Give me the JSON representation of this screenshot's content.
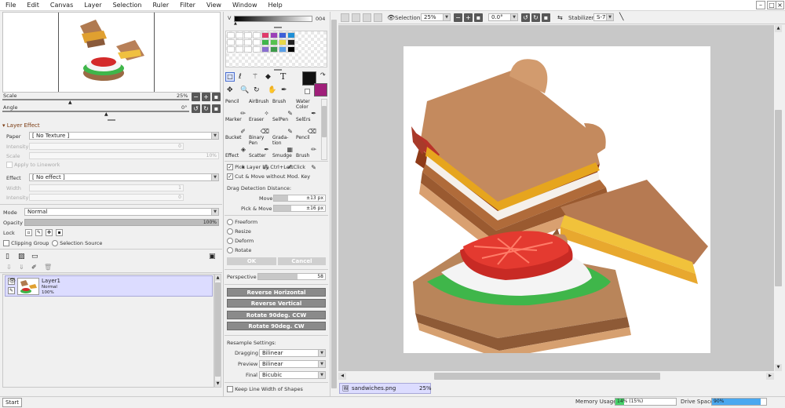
{
  "menu": [
    "File",
    "Edit",
    "Canvas",
    "Layer",
    "Selection",
    "Ruler",
    "Filter",
    "View",
    "Window",
    "Help"
  ],
  "window_controls": [
    "–",
    "□",
    "×"
  ],
  "navigator": {
    "scale_label": "Scale",
    "scale_value": "25%",
    "angle_label": "Angle",
    "angle_value": "0°"
  },
  "layer_effect": {
    "title": "Layer Effect",
    "paper_label": "Paper",
    "paper_value": "[ No Texture ]",
    "intensity_label": "Intensity",
    "intensity_value": "0",
    "scale_label": "Scale",
    "scale_value": "10%",
    "apply_linework": "Apply to Linework",
    "effect_label": "Effect",
    "effect_value": "[ No effect ]",
    "width_label": "Width",
    "width_value": "1",
    "intensity2_label": "Intensity",
    "intensity2_value": "0"
  },
  "layer_props": {
    "mode_label": "Mode",
    "mode_value": "Normal",
    "opacity_label": "Opacity",
    "opacity_value": "100%",
    "lock_label": "Lock",
    "clipping_group": "Clipping Group",
    "selection_source": "Selection Source"
  },
  "layers": [
    {
      "name": "Layer1",
      "mode": "Normal",
      "opacity": "100%"
    }
  ],
  "color": {
    "value_label": "V",
    "value": "004"
  },
  "swatches": [
    "#ffffff",
    "#ffffff",
    "#ffffff",
    "#ffffff",
    "#e03a6a",
    "#9b3fb8",
    "#3c5fd8",
    "#1f8fd6",
    "#ffffff",
    "#ffffff",
    "#ffffff",
    "#ffffff",
    "#3fb64a",
    "#56c24f",
    "#e8d848",
    "#222222",
    "#ffffff",
    "#ffffff",
    "#ffffff",
    "#ffffff",
    "#8a6fd0",
    "#3d9a4a",
    "#5aa0e8",
    "#000000"
  ],
  "primary_color": "#111111",
  "secondary_color": "#a0207a",
  "tools": [
    {
      "l1": "Pencil",
      "l2": ""
    },
    {
      "l1": "AirBrush",
      "l2": ""
    },
    {
      "l1": "Brush",
      "l2": ""
    },
    {
      "l1": "Water",
      "l2": "Color"
    },
    {
      "l1": "Marker",
      "l2": ""
    },
    {
      "l1": "Eraser",
      "l2": ""
    },
    {
      "l1": "SelPen",
      "l2": ""
    },
    {
      "l1": "SelErs",
      "l2": ""
    },
    {
      "l1": "Bucket",
      "l2": ""
    },
    {
      "l1": "Binary",
      "l2": "Pen"
    },
    {
      "l1": "Grada-",
      "l2": "tion"
    },
    {
      "l1": "Pencil",
      "l2": ""
    },
    {
      "l1": "Effect",
      "l2": ""
    },
    {
      "l1": "Scatter",
      "l2": ""
    },
    {
      "l1": "Smudge",
      "l2": ""
    },
    {
      "l1": "Brush",
      "l2": ""
    }
  ],
  "transform": {
    "pick_layer": "Pick Layer by Ctrl+LeftClick",
    "cut_move": "Cut & Move without Mod. Key",
    "drag_detect": "Drag Detection Distance:",
    "move_label": "Move",
    "move_value": "±13 px",
    "pickmove_label": "Pick & Move",
    "pickmove_value": "±16 px",
    "modes": [
      "Freeform",
      "Resize",
      "Deform",
      "Rotate"
    ],
    "ok": "OK",
    "cancel": "Cancel",
    "perspective_label": "Perspective",
    "perspective_value": "58",
    "buttons": [
      "Reverse Horizontal",
      "Reverse Vertical",
      "Rotate 90deg. CCW",
      "Rotate 90deg. CW"
    ],
    "resample_label": "Resample Settings:",
    "dragging_label": "Dragging",
    "dragging_value": "Bilinear",
    "preview_label": "Preview",
    "preview_value": "Bilinear",
    "final_label": "Final",
    "final_value": "Bicubic",
    "keep_line": "Keep Line Width of Shapes"
  },
  "toolbar": {
    "selection_label": "Selection",
    "zoom_value": "25%",
    "angle_value": "0.0°",
    "stabilizer_label": "Stabilizer",
    "stabilizer_value": "S-7"
  },
  "document_tab": {
    "name": "sandwiches.png",
    "zoom": "25%"
  },
  "status": {
    "start": "Start",
    "memory_label": "Memory Usage",
    "memory_value": "14% (15%)",
    "memory_fraction": 0.14,
    "drive_label": "Drive Space",
    "drive_value": "90%",
    "drive_fraction": 0.9
  }
}
